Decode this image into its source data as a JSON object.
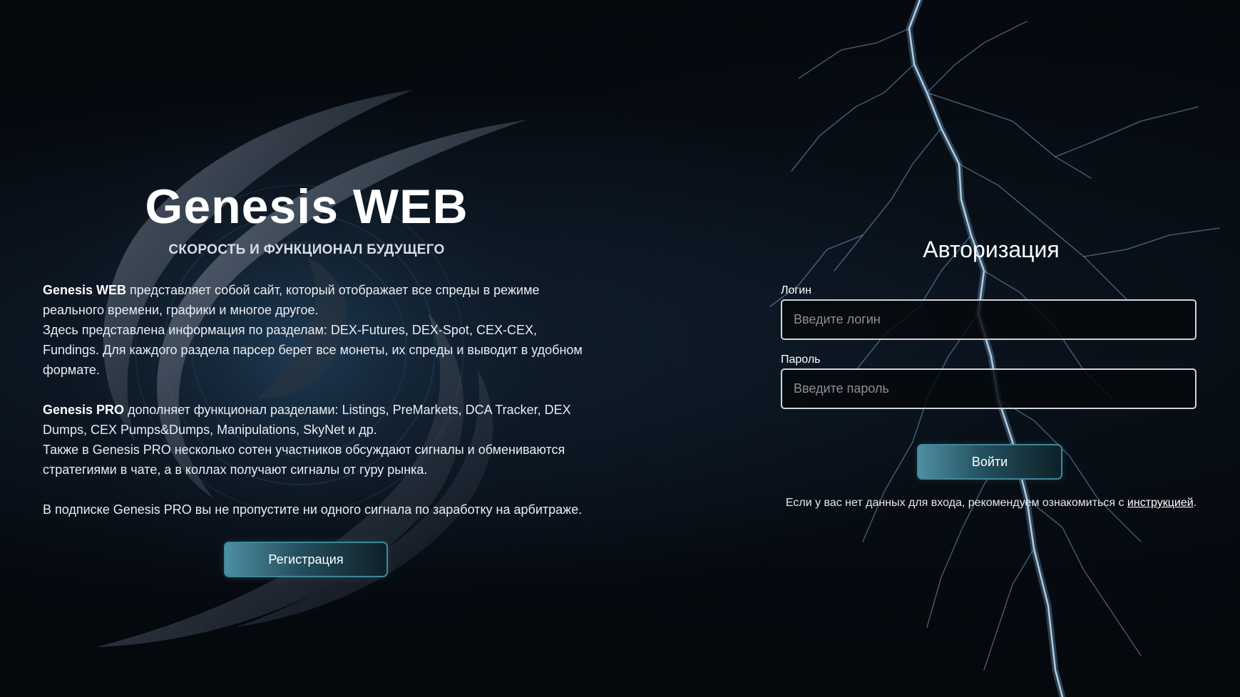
{
  "brand": {
    "title": "Genesis WEB",
    "subtitle": "СКОРОСТЬ И ФУНКЦИОНАЛ БУДУЩЕГО"
  },
  "description": {
    "p1_bold": "Genesis WEB",
    "p1_text": " представляет собой сайт, который отображает все спреды в режиме реального времени, графики и многое другое.",
    "p2_text": "Здесь представлена информация по разделам: DEX-Futures, DEX-Spot, CEX-CEX, Fundings. Для каждого раздела парсер берет все монеты, их спреды и выводит в удобном формате.",
    "p3_bold": "Genesis PRO",
    "p3_text": " дополняет функционал разделами: Listings, PreMarkets, DCA Tracker, DEX Dumps, CEX Pumps&Dumps, Manipulations, SkyNet и др.",
    "p4_text": "Также в Genesis PRO несколько сотен участников обсуждают сигналы и обмениваются стратегиями в чате, а в коллах получают сигналы от гуру рынка.",
    "p5_text": "В подписке Genesis PRO вы не пропустите ни одного сигнала по заработку на арбитраже."
  },
  "register_button": "Регистрация",
  "auth": {
    "title": "Авторизация",
    "login_label": "Логин",
    "login_placeholder": "Введите логин",
    "password_label": "Пароль",
    "password_placeholder": "Введите пароль",
    "submit_label": "Войти",
    "hint_text": "Если у вас нет данных для входа, рекомендуем ознакомиться с ",
    "hint_link": "инструкцией",
    "hint_end": "."
  },
  "colors": {
    "background": "#05080d",
    "button_gradient_start": "#4f8ea3",
    "button_gradient_end": "#0e2027",
    "button_border": "#3f8798",
    "input_border": "#cfd4d9"
  }
}
